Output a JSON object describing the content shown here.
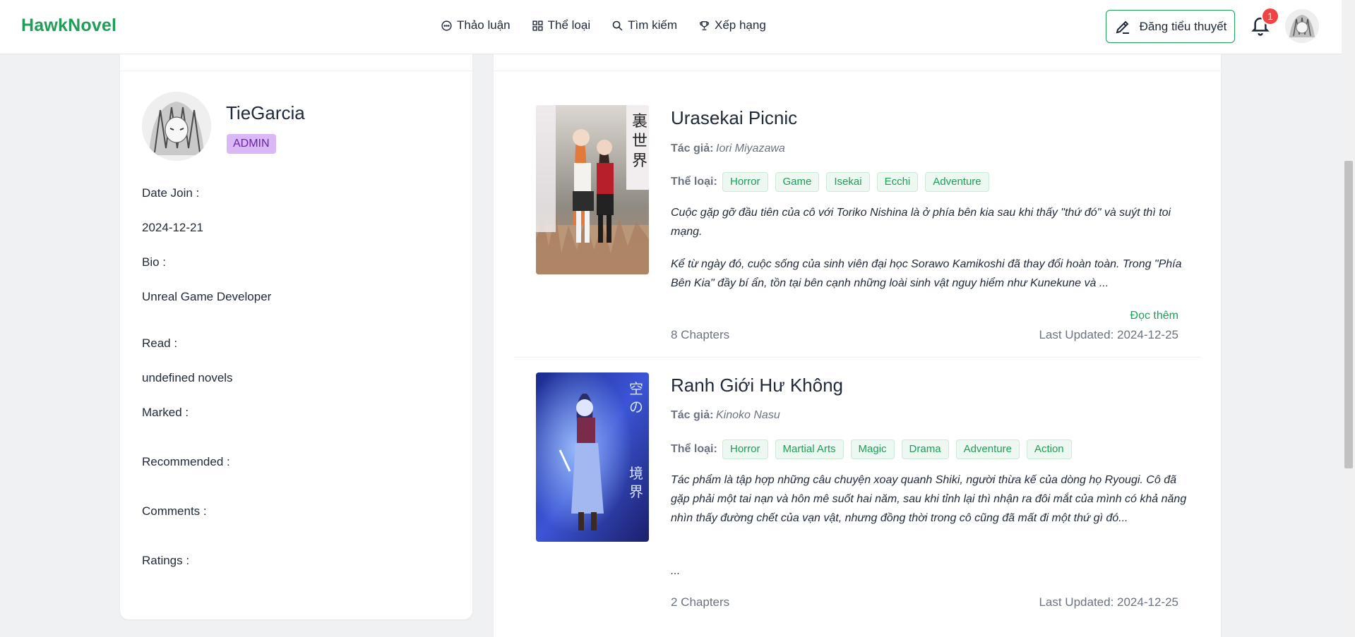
{
  "header": {
    "logo": "HawkNovel",
    "nav": [
      {
        "label": "Thảo luận",
        "icon": "chat-icon"
      },
      {
        "label": "Thể loại",
        "icon": "grid-icon"
      },
      {
        "label": "Tìm kiếm",
        "icon": "search-icon"
      },
      {
        "label": "Xếp hạng",
        "icon": "trophy-icon"
      }
    ],
    "post_button": "Đăng tiểu thuyết",
    "notification_count": "1"
  },
  "profile": {
    "username": "TieGarcia",
    "role": "ADMIN",
    "date_join_label": "Date Join :",
    "date_join_value": "2024-12-21",
    "bio_label": "Bio :",
    "bio_value": "Unreal Game Developer",
    "read_label": "Read :",
    "read_value": "undefined novels",
    "marked_label": "Marked :",
    "recommended_label": "Recommended :",
    "comments_label": "Comments :",
    "ratings_label": "Ratings :"
  },
  "novels": [
    {
      "title": "Urasekai Picnic",
      "author_label": "Tác giả:",
      "author": "Iori Miyazawa",
      "genre_label": "Thể loại:",
      "tags": [
        "Horror",
        "Game",
        "Isekai",
        "Ecchi",
        "Adventure"
      ],
      "desc1": "Cuộc gặp gỡ đầu tiên của cô với Toriko Nishina là ở phía bên kia sau khi thấy \"thứ đó\" và suýt thì toi mạng.",
      "desc2": "Kể từ ngày đó, cuộc sống của sinh viên đại học Sorawo Kamikoshi đã thay đổi hoàn toàn. Trong \"Phía Bên Kia\" đầy bí ẩn, tồn tại bên cạnh những loài sinh vật nguy hiểm như Kunekune và ...",
      "read_more": "Đọc thêm",
      "chapters": "8 Chapters",
      "updated": "Last Updated: 2024-12-25"
    },
    {
      "title": "Ranh Giới Hư Không",
      "author_label": "Tác giả:",
      "author": "Kinoko Nasu",
      "genre_label": "Thể loại:",
      "tags": [
        "Horror",
        "Martial Arts",
        "Magic",
        "Drama",
        "Adventure",
        "Action"
      ],
      "desc1": "Tác phẩm là tập hợp những câu chuyện xoay quanh Shiki, người thừa kế của dòng họ Ryougi. Cô đã gặp phải một tai nạn và hôn mê suốt hai năm, sau khi tỉnh lại thì nhận ra đôi mắt của mình có khả năng nhìn thấy đường chết của vạn vật, nhưng đồng thời trong cô cũng đã mất đi một thứ gì đó...",
      "desc2": "...",
      "chapters": "2 Chapters",
      "updated": "Last Updated: 2024-12-25"
    }
  ],
  "colors": {
    "accent": "#1e9e57",
    "badge_red": "#ef4444",
    "admin_badge": "#d9b8f5"
  }
}
